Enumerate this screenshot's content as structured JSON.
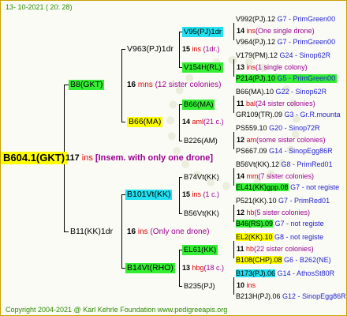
{
  "header": {
    "date": "13- 10-2021 ( 20: 28)"
  },
  "footer": {
    "copyright": "Copyright 2004-2021 @ Karl Kehrle Foundation    www.pedigreeapis.org"
  },
  "root": {
    "id": "B604.1(GKT)",
    "count": "117",
    "ins": " ins",
    "note": "  [Insem. with only one drone]"
  },
  "gen1": [
    {
      "id": "B8(GKT)",
      "count": "16",
      "unit": " mns",
      "note": " (12 sister colonies)"
    },
    {
      "id": "B11(KK)1dr",
      "count": "16",
      "unit": " ins",
      "note": "  (Only one drone)"
    }
  ],
  "gen2": [
    {
      "id": "V963(PJ)1dr",
      "count": "15",
      "unit": " ins",
      "note": " (1dr.)"
    },
    {
      "id": "B66(MA)",
      "count": "14",
      "unit": " aml",
      "note": "(21 c.)"
    },
    {
      "id": "B101Vt(KK)",
      "count": "15",
      "unit": " ins",
      "note": "  (1 c.)"
    },
    {
      "id": "B14Vt(RHO)",
      "count": "13",
      "unit": " hbg",
      "note": "(18 c.)"
    }
  ],
  "gen3": [
    {
      "id": "V95(PJ)1dr",
      "count": "14",
      "unit": " ins",
      "note": "(One single drone)"
    },
    {
      "id": "V154H(RL)",
      "count": "13",
      "unit": " ins",
      "note": "(1 single colony)"
    },
    {
      "id": "B66(MA)",
      "count": "11",
      "unit": " bal",
      "note": "(24 sister colonies)"
    },
    {
      "id": "B226(AM)",
      "count": "12",
      "unit": " am",
      "note": "(some sister colonies)"
    },
    {
      "id": "B74Vt(KK)",
      "count": "14",
      "unit": " mm",
      "note": "(7 sister colonies)"
    },
    {
      "id": "B56Vt(KK)",
      "count": "12",
      "unit": " hb",
      "note": "(5 sister colonies)"
    },
    {
      "id": "EL61(KK)",
      "count": "11",
      "unit": " hb",
      "note": "(22 sister colonies)"
    },
    {
      "id": "B235(PJ)",
      "count": "10",
      "unit": " ins",
      "note": ""
    }
  ],
  "gen4": [
    {
      "id": "V992(PJ).12",
      "tag": "G7 - PrimGreen00"
    },
    {
      "id": "V964(PJ).12",
      "tag": "G7 - PrimGreen00"
    },
    {
      "id": "V179(PM).12",
      "tag": "G24 - Sinop62R"
    },
    {
      "id": "P214(PJ).10",
      "tag": "G5 - PrimGreen00"
    },
    {
      "id": "B66(MA).10",
      "tag": "G22 - Sinop62R"
    },
    {
      "id": "GR109(TR).09",
      "tag": "G3 - Gr.R.mounta"
    },
    {
      "id": "PS559.10",
      "tag": "G20 - Sinop72R"
    },
    {
      "id": "PS667.09",
      "tag": "G14 - SinopEgg86R"
    },
    {
      "id": "B56Vt(KK).12",
      "tag": "G8 - PrimRed01"
    },
    {
      "id": "EL41(KK)gpp.08",
      "tag": "G7 - not registe"
    },
    {
      "id": "P521(KK).10",
      "tag": "G7 - PrimRed01"
    },
    {
      "id": "B46(RS).09",
      "tag": "G7 - not registe"
    },
    {
      "id": "EL2(KK).10",
      "tag": "G8 - not registe"
    },
    {
      "id": "B108(CHP).08",
      "tag": "G6 - B262(NE)"
    },
    {
      "id": "B173(PJ).06",
      "tag": "G14 - AthosSt80R"
    },
    {
      "id": "B213H(PJ).06",
      "tag": "G12 - SinopEgg86R"
    }
  ]
}
